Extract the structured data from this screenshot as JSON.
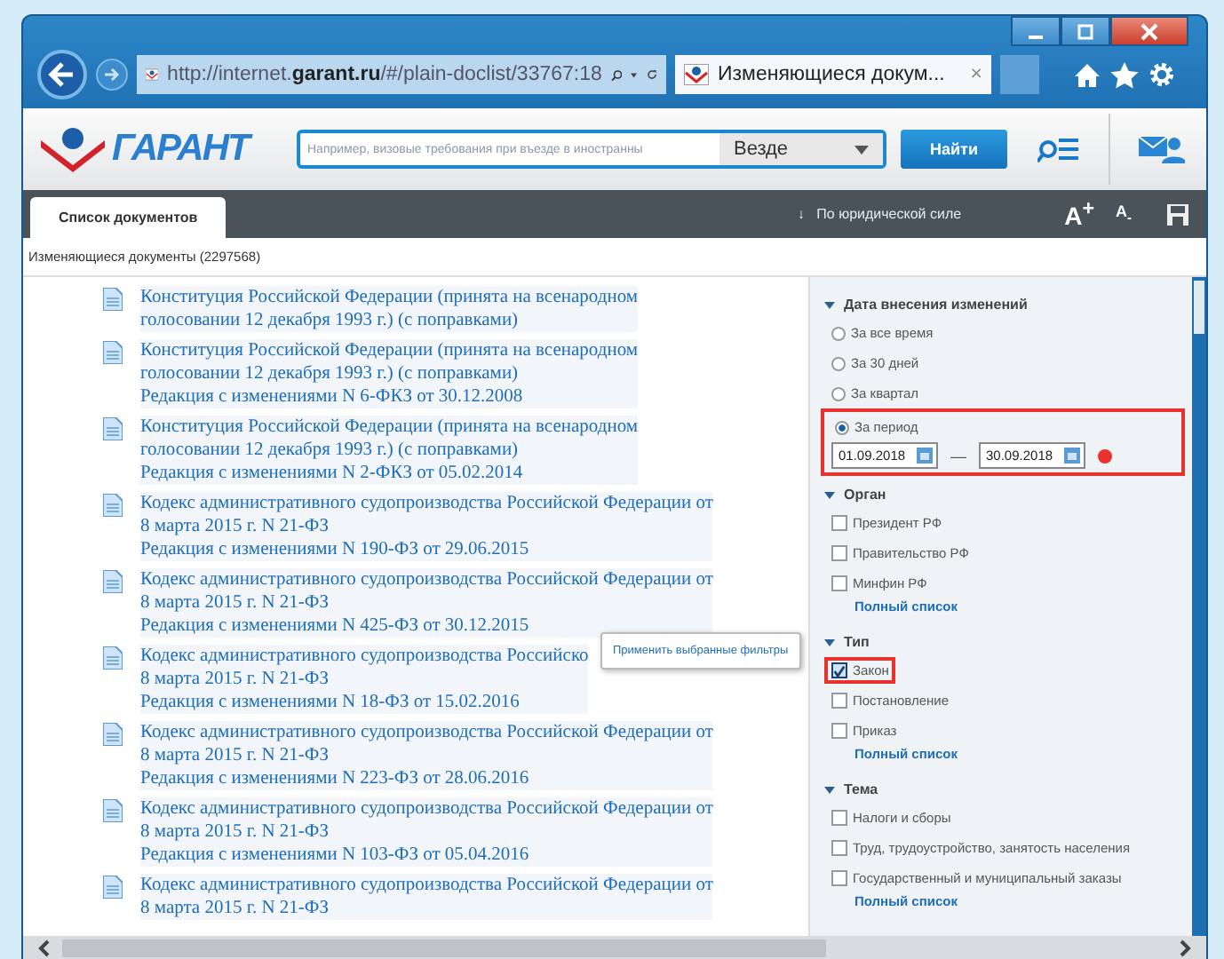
{
  "browser": {
    "address": "http://internet.**garant.ru**/#/plain-doclist/33767:18",
    "tab_title": "Изменяющиеся докум...",
    "tab_close": "×"
  },
  "toolbar": {
    "logo_text": "ГАРАНТ",
    "search_placeholder": "Например, визовые требования при въезде в иностранны",
    "scope": "Везде",
    "search_button": "Найти"
  },
  "tabs": [
    {
      "label": "Список документов",
      "selected": true
    }
  ],
  "sort": {
    "label": "По юридической силе",
    "arrow": "↓"
  },
  "font_buttons": [
    "A$^{+}$",
    "A$_{-}$"
  ],
  "list_title": "Изменяющиеся документы (2297568)",
  "documents": [
    {
      "title": "Конституция Российской Федерации (принята на всенародном\nголосовании 12 декабря 1993 г.) (с поправками)"
    },
    {
      "title": "Конституция Российской Федерации (принята на всенародном\nголосовании 12 декабря 1993 г.) (с поправками)",
      "edition": "Редакция с изменениями N 6-ФКЗ от 30.12.2008"
    },
    {
      "title": "Конституция Российской Федерации (принята на всенародном\nголосовании 12 декабря 1993 г.) (с поправками)",
      "edition": "Редакция с изменениями N 2-ФКЗ от 05.02.2014"
    },
    {
      "title": "Кодекс административного судопроизводства Российской Федерации от\n8 марта 2015 г. N 21-ФЗ",
      "edition": "Редакция с изменениями N 190-ФЗ от 29.06.2015"
    },
    {
      "title": "Кодекс административного судопроизводства Российской Федерации от\n8 марта 2015 г. N 21-ФЗ",
      "edition": "Редакция с изменениями N 425-ФЗ от 30.12.2015"
    },
    {
      "title": "Кодекс административного судопроизводства Российско\n8 марта 2015 г. N 21-ФЗ",
      "edition": "Редакция с изменениями N 18-ФЗ от 15.02.2016"
    },
    {
      "title": "Кодекс административного судопроизводства Российской Федерации от\n8 марта 2015 г. N 21-ФЗ",
      "edition": "Редакция с изменениями N 223-ФЗ от 28.06.2016"
    },
    {
      "title": "Кодекс административного судопроизводства Российской Федерации от\n8 марта 2015 г. N 21-ФЗ",
      "edition": "Редакция с изменениями N 103-ФЗ от 05.04.2016"
    },
    {
      "title": "Кодекс административного судопроизводства Российской Федерации от\n8 марта 2015 г. N 21-ФЗ"
    }
  ],
  "tooltip": "Применить выбранные фильтры",
  "filters": [
    {
      "title": "Дата внесения изменений",
      "expanded": true,
      "items": [
        {
          "kind": "radio",
          "label": "За все время",
          "selected": false,
          "highlighted": false
        },
        {
          "kind": "radio",
          "label": "За 30 дней",
          "selected": false,
          "highlighted": false
        },
        {
          "kind": "radio",
          "label": "За квартал",
          "selected": false,
          "highlighted": false
        },
        {
          "kind": "period",
          "label": "За период",
          "selected": true,
          "highlighted": true,
          "from": "01.09.2018",
          "dash": "—",
          "to": "30.09.2018"
        }
      ]
    },
    {
      "title": "Орган",
      "expanded": true,
      "items": [
        {
          "kind": "checkbox",
          "label": "Президент РФ",
          "checked": false,
          "highlighted": false
        },
        {
          "kind": "checkbox",
          "label": "Правительство РФ",
          "checked": false,
          "highlighted": false
        },
        {
          "kind": "checkbox",
          "label": "Минфин РФ",
          "checked": false,
          "highlighted": false
        },
        {
          "kind": "link",
          "label": "Полный список"
        }
      ]
    },
    {
      "title": "Тип",
      "expanded": true,
      "items": [
        {
          "kind": "checkbox",
          "label": "Закон",
          "checked": true,
          "highlighted": true
        },
        {
          "kind": "checkbox",
          "label": "Постановление",
          "checked": false,
          "highlighted": false
        },
        {
          "kind": "checkbox",
          "label": "Приказ",
          "checked": false,
          "highlighted": false
        },
        {
          "kind": "link",
          "label": "Полный список"
        }
      ]
    },
    {
      "title": "Тема",
      "expanded": true,
      "items": [
        {
          "kind": "checkbox",
          "label": "Налоги и сборы",
          "checked": false,
          "highlighted": false
        },
        {
          "kind": "checkbox",
          "label": "Труд, трудоустройство, занятость населения",
          "checked": false,
          "highlighted": false
        },
        {
          "kind": "checkbox",
          "label": "Государственный и муниципальный заказы",
          "checked": false,
          "highlighted": false
        },
        {
          "kind": "link",
          "label": "Полный список"
        }
      ]
    }
  ]
}
